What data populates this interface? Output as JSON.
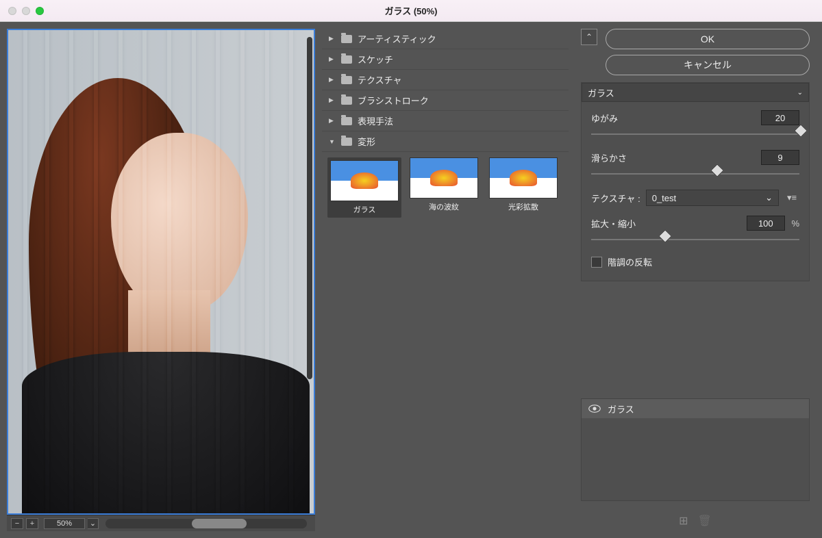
{
  "window": {
    "title": "ガラス (50%)"
  },
  "preview": {
    "zoom": "50%"
  },
  "categories": [
    {
      "label": "アーティスティック",
      "expanded": false
    },
    {
      "label": "スケッチ",
      "expanded": false
    },
    {
      "label": "テクスチャ",
      "expanded": false
    },
    {
      "label": "ブラシストローク",
      "expanded": false
    },
    {
      "label": "表現手法",
      "expanded": false
    },
    {
      "label": "変形",
      "expanded": true
    }
  ],
  "thumbnails": [
    {
      "label": "ガラス",
      "selected": true
    },
    {
      "label": "海の波紋",
      "selected": false
    },
    {
      "label": "光彩拡散",
      "selected": false
    }
  ],
  "actions": {
    "ok": "OK",
    "cancel": "キャンセル"
  },
  "filter_select": "ガラス",
  "params": {
    "distortion": {
      "label": "ゆがみ",
      "value": "20",
      "pos": 100
    },
    "smoothness": {
      "label": "滑らかさ",
      "value": "9",
      "pos": 60
    },
    "texture_label": "テクスチャ :",
    "texture_value": "0_test",
    "scale": {
      "label": "拡大・縮小",
      "value": "100",
      "unit": "%",
      "pos": 35
    },
    "invert": {
      "label": "階調の反転",
      "checked": false
    }
  },
  "layers": {
    "items": [
      {
        "name": "ガラス",
        "visible": true
      }
    ]
  }
}
